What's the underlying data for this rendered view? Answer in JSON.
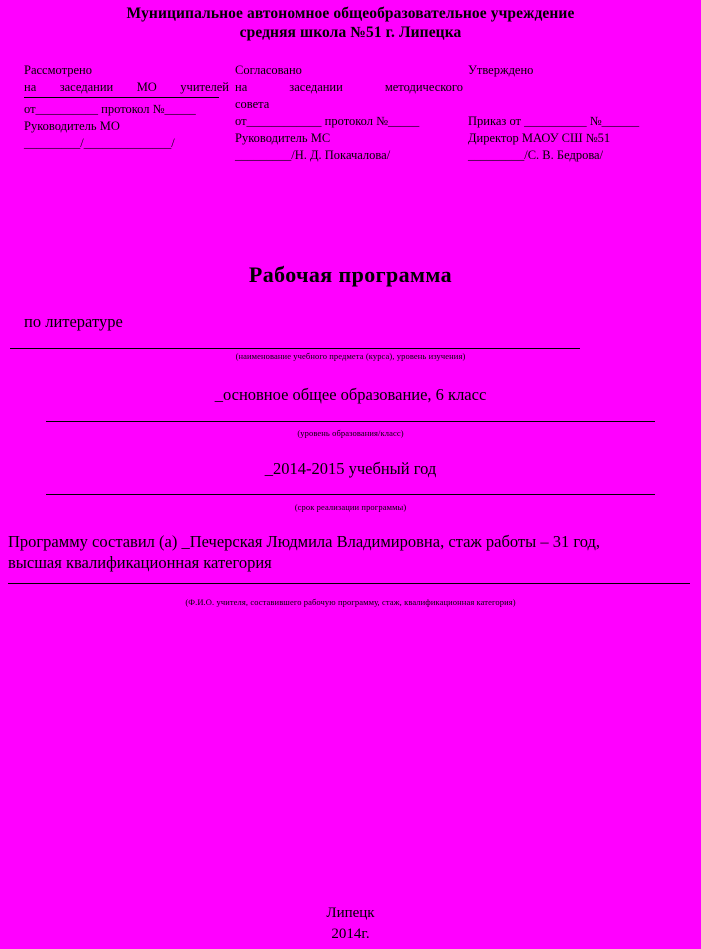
{
  "document": {
    "background_color": "#ff00ff",
    "text_color": "#000000"
  },
  "org_header": {
    "line1": "Муниципальное автономное общеобразовательное учреждение",
    "line2": "средняя школа №51 г. Липецка"
  },
  "approvals": [
    {
      "heading": "Рассмотрено",
      "body": "на  заседании  МО  учителей",
      "protocol": "от__________ протокол №_____",
      "role": "Руководитель МО",
      "signature": "_________/______________/"
    },
    {
      "heading": "Согласовано",
      "body": "на    заседании    методического",
      "body2": "совета",
      "protocol": "от____________ протокол №_____",
      "role": "Руководитель МС",
      "signature": "_________/Н. Д. Покачалова/"
    },
    {
      "heading": "Утверждено",
      "protocol": "Приказ от __________ №______",
      "role": "Директор МАОУ СШ №51",
      "signature": "_________/С. В. Бедрова/"
    }
  ],
  "title": "Рабочая программа",
  "fields": {
    "subject": {
      "value": "по   литературе",
      "caption": "(наименование учебного предмета (курса), уровень изучения)"
    },
    "level": {
      "value": "_основное общее образование, 6 класс",
      "caption": "(уровень образования/класс)"
    },
    "year": {
      "value": "_2014-2015 учебный год",
      "caption": "(срок реализации программы)"
    },
    "author": {
      "line1": "Программу составил (а) _Печерская Людмила Владимировна, стаж работы – 31  год,",
      "line2": "высшая квалификационная категория",
      "caption": "(Ф.И.О. учителя, составившего рабочую программу, стаж,  квалификационная категория)"
    }
  },
  "footer": {
    "city": "Липецк",
    "year": "2014г."
  }
}
